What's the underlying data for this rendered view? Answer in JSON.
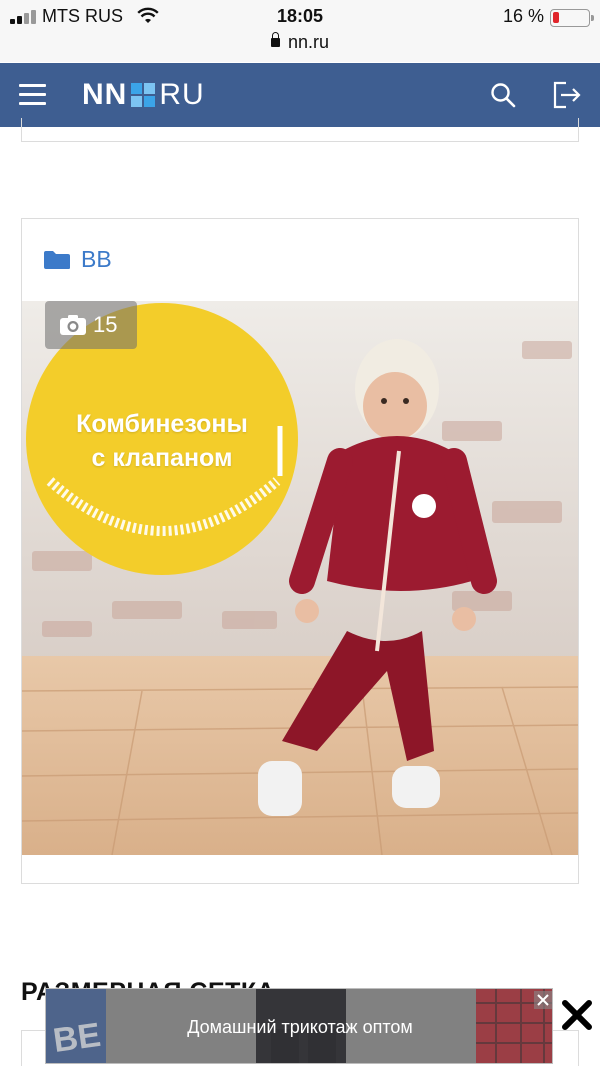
{
  "status_bar": {
    "carrier": "MTS RUS",
    "time": "18:05",
    "battery_percent": "16 %",
    "battery_level": 0.16,
    "url": "nn.ru"
  },
  "header": {
    "logo_left": "NN",
    "logo_right": "RU",
    "brand_colors": [
      "#3e5e91",
      "#ffffff",
      "#3ba4e8"
    ],
    "icons": [
      "menu-icon",
      "search-icon",
      "login-icon"
    ]
  },
  "card": {
    "rubric": "ВВ",
    "photo_count": "15",
    "promo_text_line1": "Комбинезоны",
    "promo_text_line2": "с клапаном"
  },
  "section": {
    "heading": "РАЗМЕРНАЯ СЕТКА"
  },
  "ad": {
    "text": "Домашний трикотаж оптом"
  },
  "colors": {
    "accent_link": "#3c7ac9",
    "header_bg": "#3e5e91",
    "battery_low": "#e0252b"
  }
}
